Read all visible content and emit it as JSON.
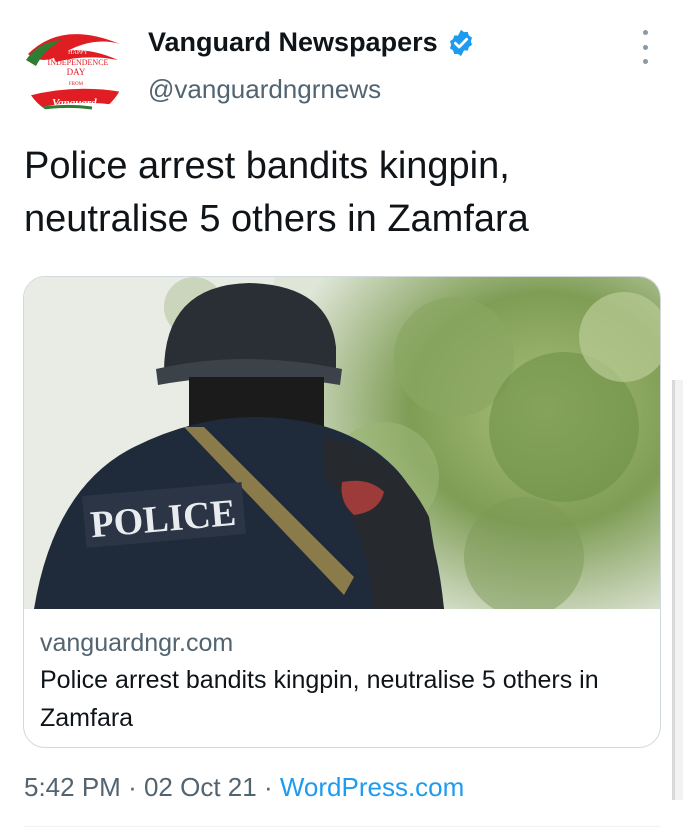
{
  "account": {
    "display_name": "Vanguard Newspapers",
    "handle": "@vanguardngrnews",
    "verified": true,
    "avatar_logo_text": [
      "HAPPY",
      "INDEPENDENCE",
      "DAY",
      "FROM",
      "Vanguard"
    ],
    "avatar_colors": {
      "green": "#2e7d32",
      "red": "#e11d24",
      "white": "#ffffff"
    }
  },
  "tweet": {
    "text": "Police arrest bandits kingpin, neutralise 5 others in Zamfara"
  },
  "card": {
    "image_text": "POLICE",
    "domain": "vanguardngr.com",
    "title": "Police arrest bandits kingpin, neutralise 5 others in Zamfara"
  },
  "meta": {
    "time": "5:42 PM",
    "separator": "·",
    "date": "02 Oct 21",
    "source": "WordPress.com"
  },
  "icons": {
    "verified": "verified-badge-icon",
    "more": "more-vertical-icon"
  },
  "colors": {
    "text": "#0f1419",
    "secondary": "#536471",
    "link": "#1d9bf0",
    "verified": "#1d9bf0",
    "border": "#cfd9de"
  }
}
